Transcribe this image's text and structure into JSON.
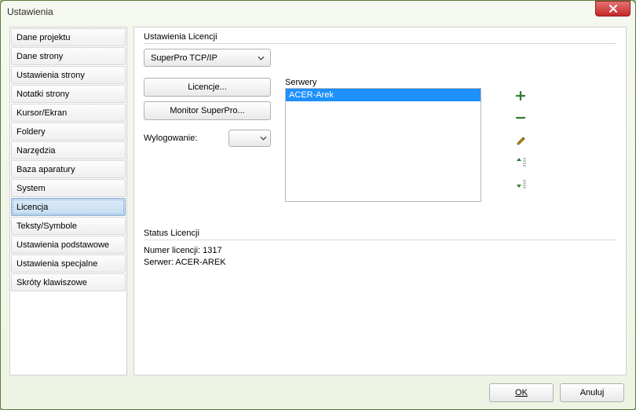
{
  "window": {
    "title": "Ustawienia"
  },
  "sidebar": {
    "items": [
      {
        "label": "Dane projektu"
      },
      {
        "label": "Dane strony"
      },
      {
        "label": "Ustawienia strony"
      },
      {
        "label": "Notatki strony"
      },
      {
        "label": "Kursor/Ekran"
      },
      {
        "label": "Foldery"
      },
      {
        "label": "Narzędzia"
      },
      {
        "label": "Baza aparatury"
      },
      {
        "label": "System"
      },
      {
        "label": "Licencja",
        "selected": true
      },
      {
        "label": "Teksty/Symbole"
      },
      {
        "label": "Ustawienia podstawowe"
      },
      {
        "label": "Ustawienia specjalne"
      },
      {
        "label": "Skróty klawiszowe"
      }
    ]
  },
  "license": {
    "group_label": "Ustawienia Licencji",
    "type_combo": "SuperPro TCP/IP",
    "btn_licenses": "Licencje...",
    "btn_monitor": "Monitor SuperPro...",
    "logout_label": "Wylogowanie:",
    "logout_value": "",
    "servers_label": "Serwery",
    "servers": [
      {
        "name": "ACER-Arek",
        "selected": true
      }
    ]
  },
  "status": {
    "group_label": "Status Licencji",
    "line1": "Numer licencji: 1317",
    "line2": "Serwer: ACER-AREK"
  },
  "footer": {
    "ok": "OK",
    "cancel": "Anuluj"
  }
}
